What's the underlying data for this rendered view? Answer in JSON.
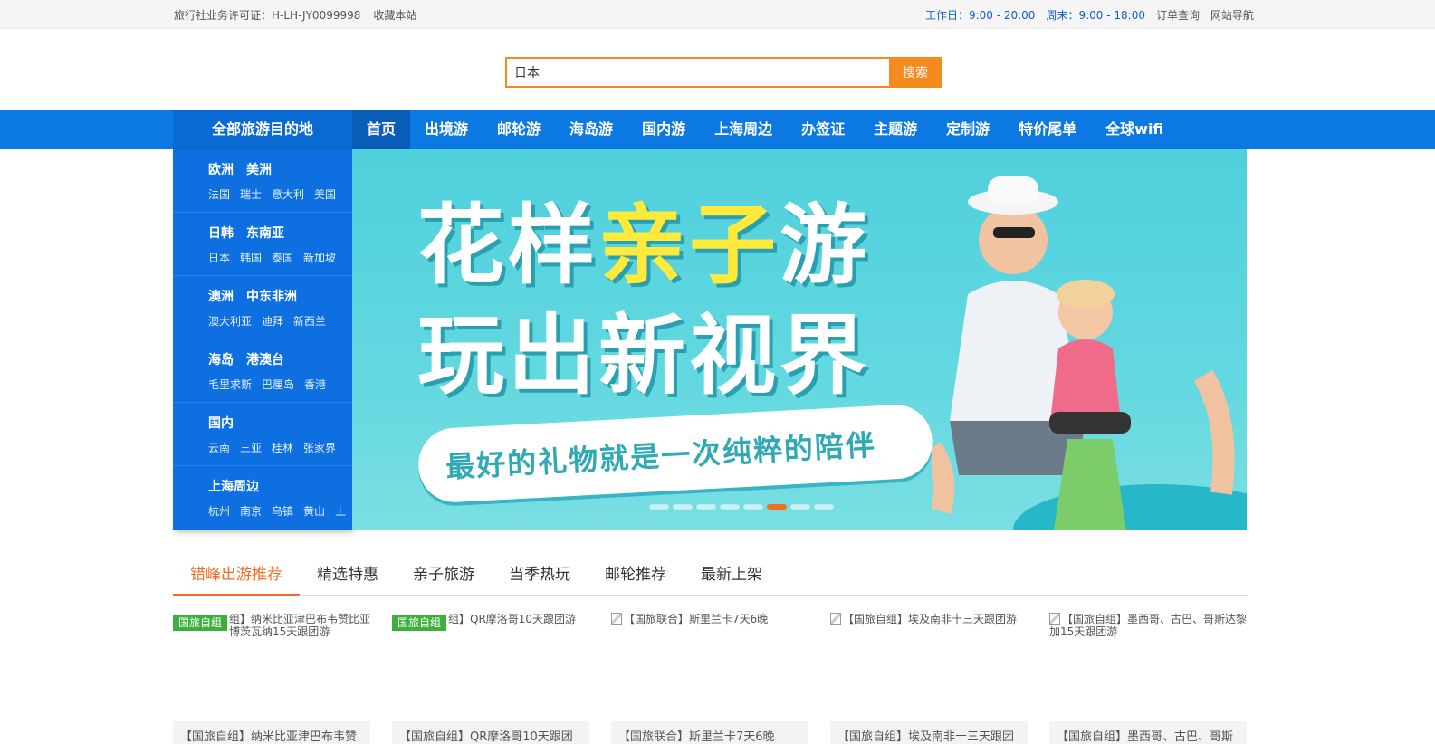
{
  "topbar": {
    "license": "旅行社业务许可证：H-LH-JY0099998",
    "bookmark": "收藏本站",
    "workday_label": "工作日：",
    "workday_hours": "9:00 - 20:00",
    "weekend_label": "周末：",
    "weekend_hours": "9:00 - 18:00",
    "order_query": "订单查询",
    "site_nav": "网站导航"
  },
  "search": {
    "value": "日本",
    "button": "搜索"
  },
  "nav": {
    "all_destinations": "全部旅游目的地",
    "items": [
      "首页",
      "出境游",
      "邮轮游",
      "海岛游",
      "国内游",
      "上海周边",
      "办签证",
      "主题游",
      "定制游",
      "特价尾单",
      "全球wifi"
    ]
  },
  "sidemenu": [
    {
      "titles": [
        "欧洲",
        "美洲"
      ],
      "items": [
        "法国",
        "瑞士",
        "意大利",
        "美国"
      ]
    },
    {
      "titles": [
        "日韩",
        "东南亚"
      ],
      "items": [
        "日本",
        "韩国",
        "泰国",
        "新加坡"
      ]
    },
    {
      "titles": [
        "澳洲",
        "中东非洲"
      ],
      "items": [
        "澳大利亚",
        "迪拜",
        "新西兰"
      ]
    },
    {
      "titles": [
        "海岛",
        "港澳台"
      ],
      "items": [
        "毛里求斯",
        "巴厘岛",
        "香港"
      ]
    },
    {
      "titles": [
        "国内"
      ],
      "items": [
        "云南",
        "三亚",
        "桂林",
        "张家界"
      ]
    },
    {
      "titles": [
        "上海周边"
      ],
      "items": [
        "杭州",
        "南京",
        "乌镇",
        "黄山",
        "上"
      ]
    }
  ],
  "banner": {
    "line1_a": "花样",
    "line1_b": "亲子",
    "line1_c": "游",
    "line2": "玩出新视界",
    "slogan": "最好的礼物就是一次纯粹的陪伴",
    "slide_count": 8,
    "active_slide": 6
  },
  "tabs": [
    "错峰出游推荐",
    "精选特惠",
    "亲子旅游",
    "当季热玩",
    "邮轮推荐",
    "最新上架"
  ],
  "products": [
    {
      "badge": "国旅自组",
      "text": "组】纳米比亚津巴布韦赞比亚博茨瓦纳15天跟团游"
    },
    {
      "badge": "国旅自组",
      "text": "组】QR摩洛哥10天跟团游"
    },
    {
      "badge": "",
      "text": "【国旅联合】斯里兰卡7天6晚"
    },
    {
      "badge": "",
      "text": "【国旅自组】埃及南非十三天跟团游"
    },
    {
      "badge": "",
      "text": "【国旅自组】墨西哥、古巴、哥斯达黎加15天跟团游"
    }
  ],
  "cards": [
    "【国旅自组】纳米比亚津巴布韦赞",
    "【国旅自组】QR摩洛哥10天跟团",
    "【国旅联合】斯里兰卡7天6晚",
    "【国旅自组】埃及南非十三天跟团",
    "【国旅自组】墨西哥、古巴、哥斯"
  ],
  "colors": {
    "nav_blue": "#0c78e2",
    "accent_orange": "#f58a1e",
    "tab_orange": "#f26c21",
    "badge_green": "#3bb13b"
  }
}
